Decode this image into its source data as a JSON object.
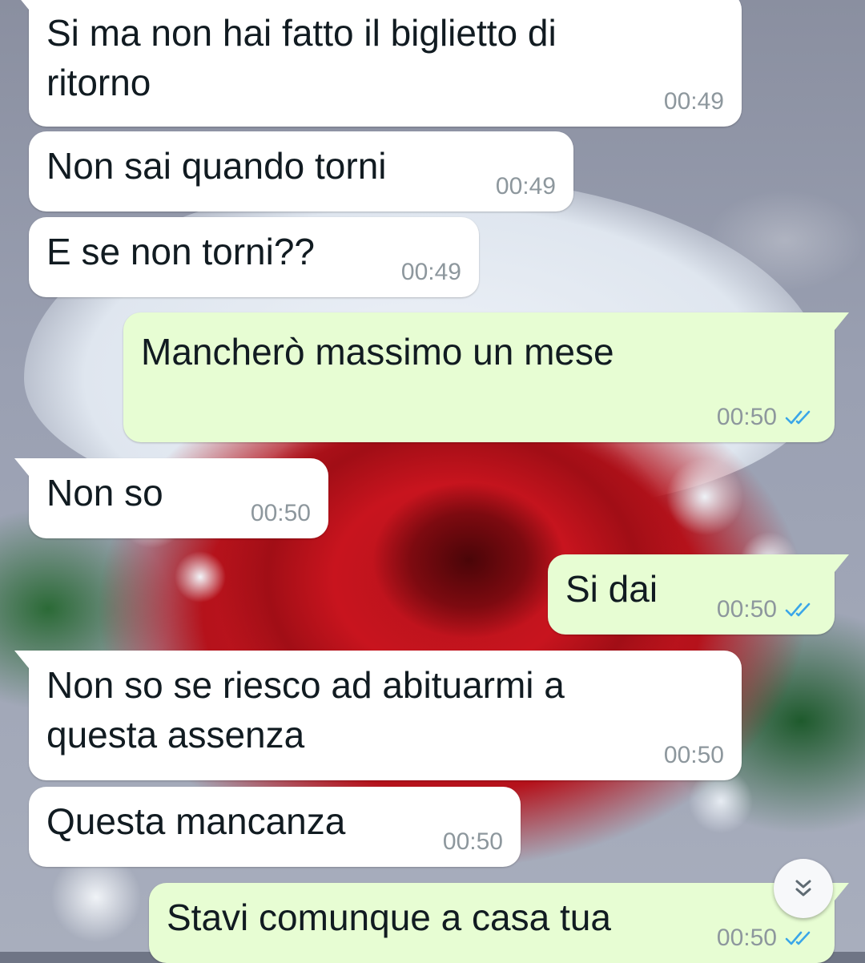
{
  "chat": {
    "messages": [
      {
        "direction": "in",
        "text": "Si ma non hai fatto il biglietto di\nritorno",
        "time": "00:49"
      },
      {
        "direction": "in",
        "text": "Non sai quando torni",
        "time": "00:49"
      },
      {
        "direction": "in",
        "text": "E se non torni??",
        "time": "00:49"
      },
      {
        "direction": "out",
        "text": "Mancherò massimo un mese",
        "time": "00:50",
        "status": "read"
      },
      {
        "direction": "in",
        "text": "Non so",
        "time": "00:50"
      },
      {
        "direction": "out",
        "text": "Si dai",
        "time": "00:50",
        "status": "read"
      },
      {
        "direction": "in",
        "text": "Non so se riesco ad abituarmi a\nquesta assenza",
        "time": "00:50"
      },
      {
        "direction": "in",
        "text": "Questa mancanza",
        "time": "00:50"
      },
      {
        "direction": "out",
        "text": "Stavi comunque a casa tua",
        "time": "00:50",
        "status": "read"
      }
    ]
  },
  "icons": {
    "read_receipt": "double-check-icon",
    "scroll_down": "chevrons-down-icon"
  },
  "colors": {
    "incoming_bubble": "#ffffff",
    "outgoing_bubble": "#e7fdd3",
    "timestamp": "#8d979d",
    "read_ticks": "#3aa6e8"
  }
}
